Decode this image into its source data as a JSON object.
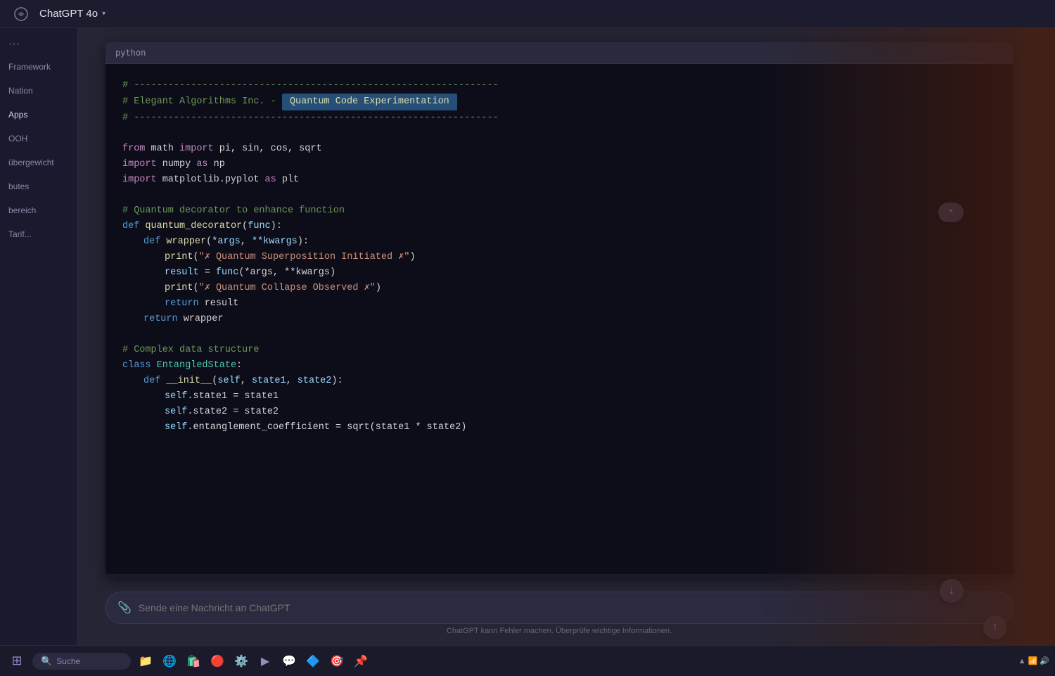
{
  "topbar": {
    "logo_symbol": "⟳",
    "title": "ChatGPT 4o",
    "chevron": "▾"
  },
  "sidebar": {
    "items": [
      {
        "label": ""
      },
      {
        "label": "···"
      },
      {
        "label": "Framework"
      },
      {
        "label": "Nation"
      },
      {
        "label": "Apps"
      },
      {
        "label": "OOH"
      },
      {
        "label": "übergewicht"
      },
      {
        "label": "butes"
      },
      {
        "label": "bereich"
      },
      {
        "label": "Tarif..."
      }
    ]
  },
  "code": {
    "language": "python",
    "header_label": "python",
    "lines": [
      "# ----------------------------------------------------------------",
      "# Elegant Algorithms Inc. -  Quantum Code Experimentation ",
      "# ----------------------------------------------------------------",
      "",
      "from math import pi, sin, cos, sqrt",
      "import numpy as np",
      "import matplotlib.pyplot as plt",
      "",
      "# Quantum decorator to enhance function",
      "def quantum_decorator(func):",
      "    def wrapper(*args, **kwargs):",
      "        print(\"✗ Quantum Superposition Initiated ✗\")",
      "        result = func(*args, **kwargs)",
      "        print(\"✗ Quantum Collapse Observed ✗\")",
      "        return result",
      "    return wrapper",
      "",
      "# Complex data structure",
      "class EntangledState:",
      "    def __init__(self, state1, state2):",
      "        self.state1 = state1",
      "        self.state2 = state2",
      "        self.entanglement_coefficient = sqrt(state1 * state2)"
    ]
  },
  "chat": {
    "input_placeholder": "Sende eine Nachricht an ChatGPT",
    "footer_note": "ChatGPT kann Fehler machen. Überprüfe wichtige Informationen.",
    "attach_icon": "📎"
  },
  "taskbar": {
    "search_placeholder": "Suche",
    "start_icon": "⊞"
  }
}
